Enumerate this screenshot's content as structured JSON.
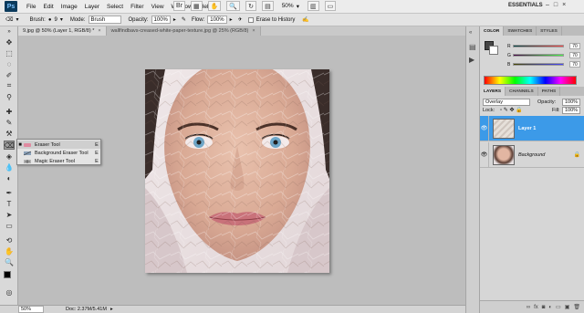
{
  "menubar": {
    "logo": "Ps",
    "items": [
      "File",
      "Edit",
      "Image",
      "Layer",
      "Select",
      "Filter",
      "View",
      "Window",
      "Help"
    ],
    "zoom": "50%",
    "workspace": "ESSENTIALS",
    "window_controls": [
      "–",
      "□",
      "×"
    ]
  },
  "options": {
    "brush_label": "Brush:",
    "brush_size": "9",
    "mode_label": "Mode:",
    "mode_value": "Brush",
    "opacity_label": "Opacity:",
    "opacity_value": "100%",
    "flow_label": "Flow:",
    "flow_value": "100%",
    "erase_history_label": "Erase to History"
  },
  "tabs": [
    {
      "label": "9.jpg @ 50% (Layer 1, RGB/8) *",
      "active": true
    },
    {
      "label": "wallfindbavs-creased-white-paper-texture.jpg @ 25% (RGB/8)",
      "active": false
    }
  ],
  "flyout": {
    "items": [
      {
        "label": "Eraser Tool",
        "key": "E",
        "selected": true
      },
      {
        "label": "Background Eraser Tool",
        "key": "E",
        "selected": false
      },
      {
        "label": "Magic Eraser Tool",
        "key": "E",
        "selected": false
      }
    ]
  },
  "status": {
    "zoom": "50%",
    "doc": "Doc: 2.37M/5.41M"
  },
  "color_panel": {
    "tabs": [
      "COLOR",
      "SWATCHES",
      "STYLES"
    ],
    "channels": [
      {
        "label": "R",
        "value": "70"
      },
      {
        "label": "G",
        "value": "70"
      },
      {
        "label": "B",
        "value": "70"
      }
    ]
  },
  "layers_panel": {
    "tabs": [
      "LAYERS",
      "CHANNELS",
      "PATHS"
    ],
    "blend_mode": "Overlay",
    "opacity_label": "Opacity:",
    "opacity_value": "100%",
    "lock_label": "Lock:",
    "fill_label": "Fill:",
    "fill_value": "100%",
    "layers": [
      {
        "name": "Layer 1",
        "selected": true
      },
      {
        "name": "Background",
        "selected": false
      }
    ]
  }
}
